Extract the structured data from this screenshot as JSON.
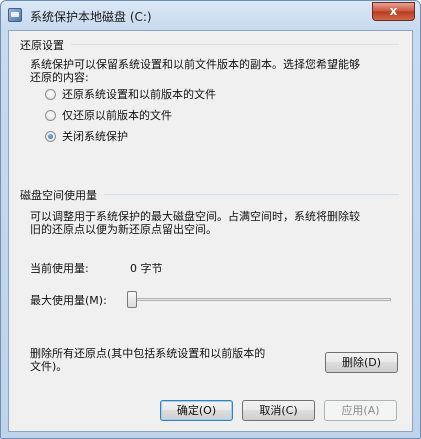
{
  "window": {
    "title": "系统保护本地磁盘 (C:)",
    "close_label": "x"
  },
  "restore_settings": {
    "group_title": "还原设置",
    "description_line1": "系统保护可以保留系统设置和以前文件版本的副本。选择您希望能够",
    "description_line2": "还原的内容:",
    "options": [
      {
        "label": "还原系统设置和以前版本的文件",
        "checked": false
      },
      {
        "label": "仅还原以前版本的文件",
        "checked": false
      },
      {
        "label": "关闭系统保护",
        "checked": true
      }
    ]
  },
  "disk_usage": {
    "group_title": "磁盘空间使用量",
    "description_line1": "可以调整用于系统保护的最大磁盘空间。占满空间时，系统将删除较",
    "description_line2": "旧的还原点以便为新还原点留出空间。",
    "current_usage_label": "当前使用量:",
    "current_usage_value": "0 字节",
    "max_usage_label": "最大使用量(M):",
    "max_usage_level": 0
  },
  "delete_section": {
    "description_line1": "删除所有还原点(其中包括系统设置和以前版本的",
    "description_line2": "文件)。",
    "delete_button": "删除(D)"
  },
  "footer": {
    "ok_button": "确定(O)",
    "cancel_button": "取消(C)",
    "apply_button": "应用(A)"
  }
}
